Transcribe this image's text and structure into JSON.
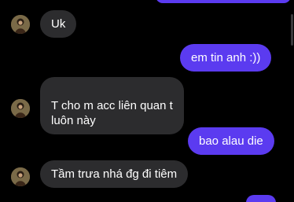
{
  "conversation": {
    "messages": [
      {
        "side": "received",
        "text": "Uk"
      },
      {
        "side": "sent",
        "text": "em tin anh :))"
      },
      {
        "side": "received",
        "text": "T cho m acc liên quan t\nluôn này"
      },
      {
        "side": "sent",
        "text": "bao alau die"
      },
      {
        "side": "received",
        "text": "Tầm trưa nhá đg đi tiêm"
      },
      {
        "side": "sent",
        "text": ""
      }
    ]
  },
  "colors": {
    "background": "#000000",
    "received_bubble": "#2c2c2e",
    "sent_bubble": "#5b3bf0",
    "text": "#ffffff"
  },
  "icons": {
    "avatar": "contact-avatar-icon"
  }
}
